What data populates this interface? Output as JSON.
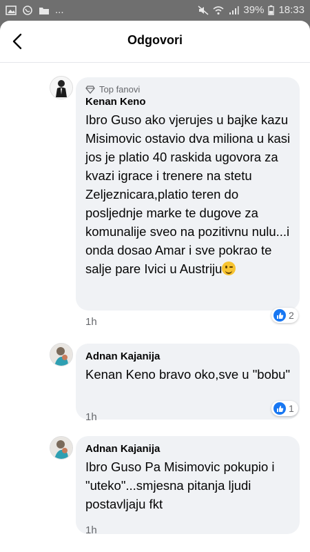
{
  "status_bar": {
    "battery": "39%",
    "time": "18:33",
    "ellipsis": "..."
  },
  "header": {
    "title": "Odgovori"
  },
  "comments": [
    {
      "badge": "Top fanovi",
      "author": "Kenan Keno",
      "text": "Ibro Guso ako vjerujes u bajke kazu Misimovic ostavio dva miliona u kasi jos je platio 40 raskida ugovora za kvazi igrace i trenere na stetu Zeljeznicara,platio teren do posljednje marke te dugove za komunalije sveo na pozitivnu nulu...i onda dosao Amar i sve pokrao te salje pare Ivici u Austriju",
      "time": "1h",
      "likes": "2"
    },
    {
      "author": "Adnan Kajanija",
      "text": "Kenan Keno bravo oko,sve u \"bobu\"",
      "time": "1h",
      "likes": "1"
    },
    {
      "author": "Adnan Kajanija",
      "text": "Ibro Guso Pa Misimovic pokupio i \"uteko\"...smjesna pitanja ljudi postavljaju fkt",
      "time": "1h"
    }
  ],
  "colors": {
    "accent": "#1877f2",
    "bubble": "#f0f2f5",
    "meta": "#65676b"
  }
}
